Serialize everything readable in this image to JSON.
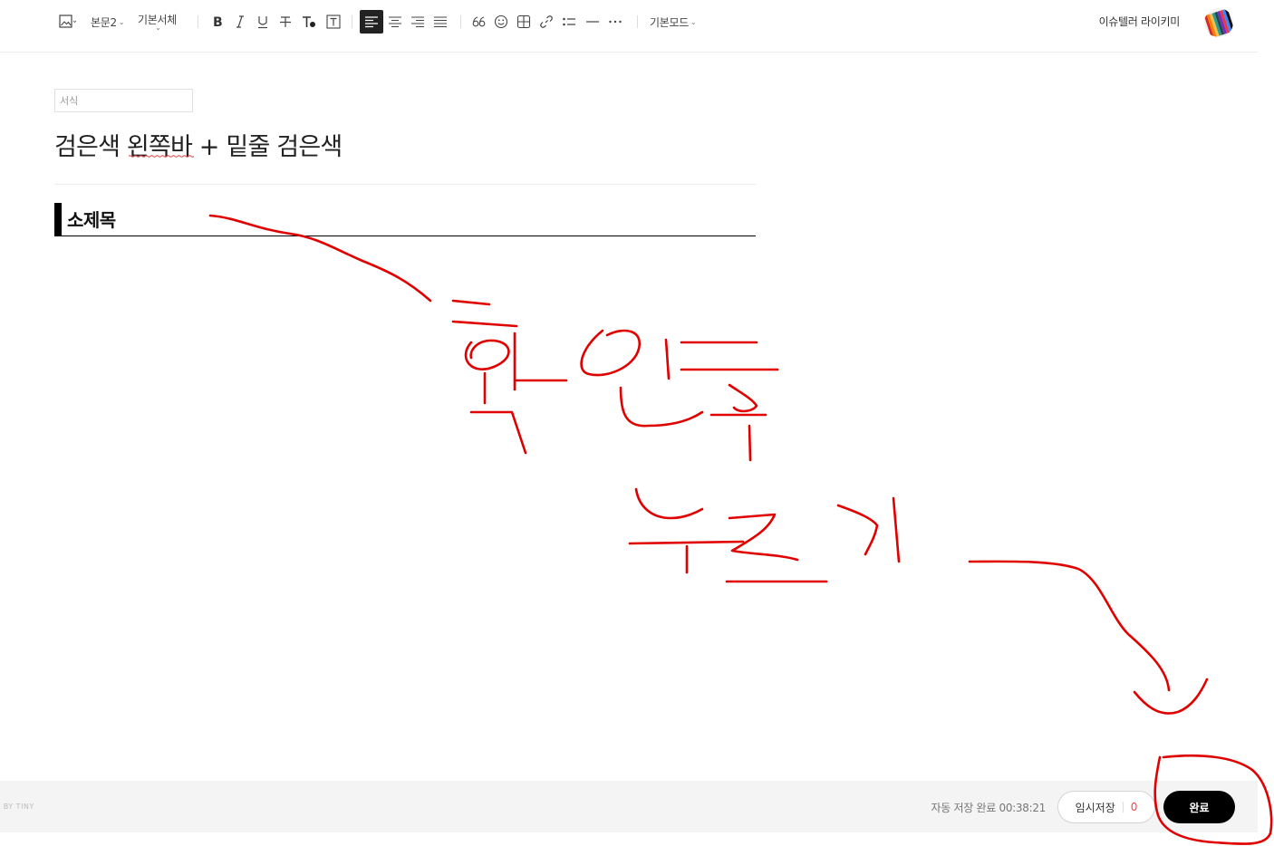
{
  "toolbar": {
    "paragraph_style": "본문2",
    "font_name": "기본서체",
    "mode_label": "기본모드",
    "user_name": "이슈텔러 라이키미",
    "icons": [
      "image-icon",
      "bold-icon",
      "italic-icon",
      "underline-icon",
      "strikethrough-icon",
      "text-color-icon",
      "text-background-icon",
      "align-left-icon",
      "align-center-icon",
      "align-right-icon",
      "align-justify-icon",
      "quote-icon",
      "emoji-icon",
      "table-icon",
      "link-icon",
      "list-icon",
      "divider-line-icon",
      "more-icon"
    ]
  },
  "editor": {
    "format_placeholder": "서식",
    "title": "검은색 왼쪽바 + 밑줄 검은색",
    "subheading": "소제목"
  },
  "footer": {
    "powered_by": "D BY TINY",
    "autosave_text": "자동 저장 완료 00:38:21",
    "draft_label": "임시저장",
    "draft_count": "0",
    "done_label": "완료"
  },
  "colors": {
    "accent_dark": "#000000",
    "annotation_red": "#e00000",
    "draft_count": "#ff4444",
    "footer_bg": "#f4f4f4"
  }
}
